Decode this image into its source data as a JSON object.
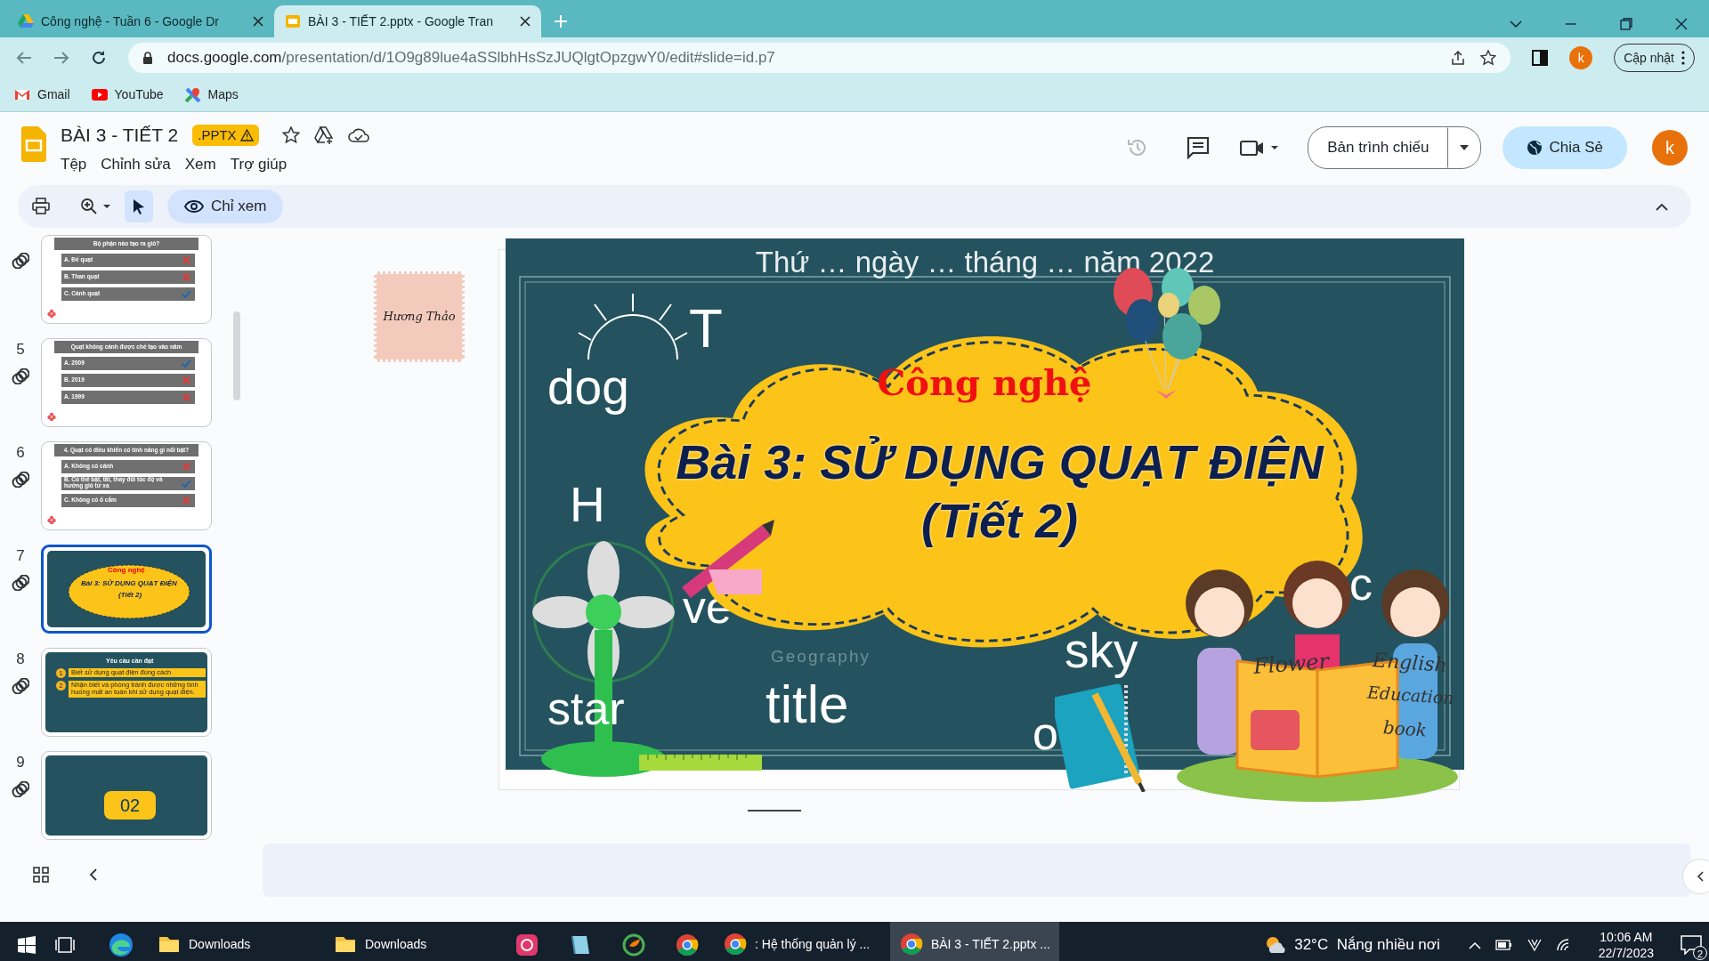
{
  "browser": {
    "tabs": [
      {
        "title": "Công nghệ - Tuần 6 - Google Dr",
        "selected": false
      },
      {
        "title": "BÀI 3 - TIẾT 2.pptx - Google Tran",
        "selected": true
      }
    ],
    "url_host": "docs.google.com",
    "url_path": "/presentation/d/1O9g89lue4aSSlbhHsSzJUQlgtOpzgwY0/edit#slide=id.p7",
    "profile": "k",
    "update_button": "Cập nhật",
    "bookmarks": [
      {
        "label": "Gmail"
      },
      {
        "label": "YouTube"
      },
      {
        "label": "Maps"
      }
    ]
  },
  "doc": {
    "title": "BÀI 3 - TIẾT 2",
    "badge": ".PPTX",
    "menus": [
      "Tệp",
      "Chỉnh sửa",
      "Xem",
      "Trợ giúp"
    ],
    "slideshow_button": "Bản trình chiếu",
    "share_button": "Chia Sẻ",
    "avatar": "k"
  },
  "toolbar": {
    "mode_button": "Chỉ xem"
  },
  "thumbnails": [
    {
      "selected": false,
      "kind": "quiz",
      "question": "Bộ phận nào tạo ra gió?",
      "answers": [
        {
          "text": "A. Đế quạt",
          "correct": false
        },
        {
          "text": "B. Than quạt",
          "correct": false
        },
        {
          "text": "C. Cánh quạt",
          "correct": true
        }
      ]
    },
    {
      "number": "5",
      "selected": false,
      "kind": "quiz",
      "question": "Quạt không cánh được chế tạo vào năm",
      "answers": [
        {
          "text": "A. 2009",
          "correct": true
        },
        {
          "text": "B. 2019",
          "correct": false
        },
        {
          "text": "A. 1999",
          "correct": false
        }
      ]
    },
    {
      "number": "6",
      "selected": false,
      "kind": "quiz",
      "question": "4. Quạt có điều khiển có tính năng gì nổi bật?",
      "answers": [
        {
          "text": "A. Không có cánh",
          "correct": false
        },
        {
          "text": "B. Có thể bật, tắt, thay đổi tốc độ và hướng gió từ xa",
          "correct": true
        },
        {
          "text": "C. Không có ổ cắm",
          "correct": false
        }
      ]
    },
    {
      "number": "7",
      "selected": true,
      "kind": "title",
      "lines": [
        "Công nghệ",
        "Bài 3: SỬ DỤNG QUẠT ĐIỆN",
        "(Tiết 2)"
      ]
    },
    {
      "number": "8",
      "selected": false,
      "kind": "goals",
      "heading": "Yêu cầu cần đạt",
      "items": [
        {
          "index": "1",
          "text": "Biết sử dụng quạt điện đúng cách"
        },
        {
          "index": "2",
          "text": "Nhận biết và phòng tránh được những tình huống mất an toàn khi sử dụng quạt điện."
        }
      ]
    },
    {
      "number": "9",
      "selected": false,
      "kind": "section",
      "lines": [
        "02"
      ]
    }
  ],
  "canvas": {
    "logo_name": "Hương Thảo"
  },
  "slide": {
    "date": "Thứ … ngày … tháng … năm 2022",
    "subject": "Công nghệ",
    "title": "Bài 3: SỬ DỤNG QUẠT ĐIỆN",
    "subtitle": "(Tiết 2)",
    "chalk_words": [
      "T",
      "dog",
      "H",
      "ve",
      "star",
      "title",
      "sky",
      "o",
      "c"
    ],
    "faint_word": "Geography",
    "book_words": [
      "Flower",
      "English",
      "Education",
      "book"
    ]
  },
  "taskbar": {
    "items": [
      {
        "kind": "edge",
        "selected": false
      },
      {
        "kind": "folder",
        "label": "Downloads",
        "selected": false
      },
      {
        "kind": "folder",
        "label": "Downloads",
        "selected": false
      },
      {
        "kind": "creative",
        "selected": false
      },
      {
        "kind": "notebook",
        "selected": false
      },
      {
        "kind": "coccoc",
        "selected": false
      },
      {
        "kind": "chrome",
        "selected": false
      },
      {
        "kind": "chrome",
        "label": ": Hệ thống quản lý ...",
        "selected": false
      },
      {
        "kind": "chrome",
        "label": "BÀI 3 - TIẾT 2.pptx ...",
        "selected": true
      }
    ],
    "weather": "32°C  Nắng nhiều nơi",
    "time": "10:06 AM",
    "date": "22/7/2023",
    "notifications": "2"
  }
}
